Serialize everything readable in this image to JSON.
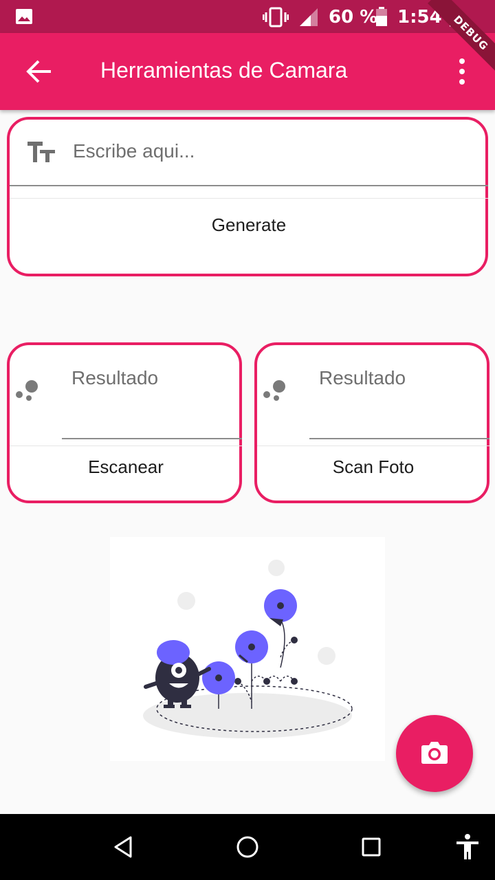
{
  "status_bar": {
    "battery_percent": "60 %",
    "time": "1:54 p. m."
  },
  "debug_banner": "DEBUG",
  "app_bar": {
    "title": "Herramientas de Camara"
  },
  "generate_card": {
    "input_placeholder": "Escribe aqui...",
    "button_label": "Generate"
  },
  "scan_cards": [
    {
      "result_placeholder": "Resultado",
      "button_label": "Escanear"
    },
    {
      "result_placeholder": "Resultado",
      "button_label": "Scan Foto"
    }
  ],
  "colors": {
    "primary": "#e91e63",
    "status_bar": "#b0194f",
    "illustration_accent": "#6c63ff"
  },
  "icons": {
    "back": "arrow-back-icon",
    "menu": "more-vert-icon",
    "text_field": "text-fields-icon",
    "fab": "camera-icon"
  }
}
